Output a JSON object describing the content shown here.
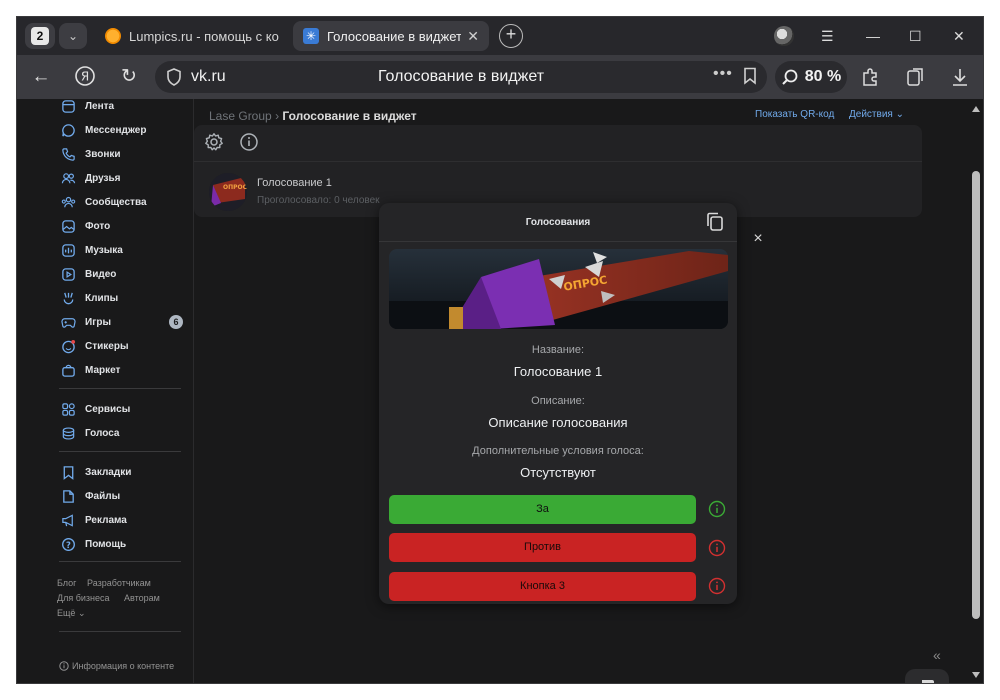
{
  "browser": {
    "tab_count": "2",
    "tabs": [
      {
        "title": "Lumpics.ru - помощь с компьютером",
        "active": false
      },
      {
        "title": "Голосование в виджет",
        "active": true
      }
    ],
    "address": {
      "domain": "vk.ru",
      "page_title": "Голосование в виджет",
      "zoom": "80 %"
    },
    "icons": [
      "back-arrow-icon",
      "yandex-icon",
      "reload-icon",
      "shield-icon",
      "more-icon",
      "bookmark-icon",
      "zoom-icon",
      "extensions-icon",
      "collections-icon",
      "downloads-icon"
    ]
  },
  "sidebar": {
    "items": [
      {
        "label": "Лента",
        "icon": "newsfeed-icon"
      },
      {
        "label": "Мессенджер",
        "icon": "messenger-icon"
      },
      {
        "label": "Звонки",
        "icon": "phone-icon"
      },
      {
        "label": "Друзья",
        "icon": "friends-icon"
      },
      {
        "label": "Сообщества",
        "icon": "communities-icon"
      },
      {
        "label": "Фото",
        "icon": "photo-icon"
      },
      {
        "label": "Музыка",
        "icon": "music-icon"
      },
      {
        "label": "Видео",
        "icon": "video-icon"
      },
      {
        "label": "Клипы",
        "icon": "clips-icon"
      },
      {
        "label": "Игры",
        "icon": "games-icon",
        "badge": "6"
      },
      {
        "label": "Стикеры",
        "icon": "stickers-icon"
      },
      {
        "label": "Маркет",
        "icon": "market-icon"
      },
      {
        "label": "Сервисы",
        "icon": "services-icon"
      },
      {
        "label": "Голоса",
        "icon": "votes-icon"
      },
      {
        "label": "Закладки",
        "icon": "bookmarks-icon"
      },
      {
        "label": "Файлы",
        "icon": "files-icon"
      },
      {
        "label": "Реклама",
        "icon": "ads-icon"
      },
      {
        "label": "Помощь",
        "icon": "help-icon"
      }
    ],
    "footer_links": [
      "Блог",
      "Разработчикам",
      "Для бизнеса",
      "Авторам",
      "Ещё"
    ],
    "content_info": "Информация о контенте"
  },
  "main": {
    "breadcrumb": {
      "parent": "Lase Group",
      "current": "Голосование в виджет"
    },
    "actions": [
      "Показать QR-код",
      "Действия"
    ],
    "poll": {
      "name": "Голосование 1",
      "voted": "Проголосовало: 0 человек"
    }
  },
  "modal": {
    "title": "Голосования",
    "cover_text": "ОПРОС",
    "fields": [
      {
        "label": "Название:",
        "value": "Голосование 1"
      },
      {
        "label": "Описание:",
        "value": "Описание голосования"
      },
      {
        "label": "Дополнительные условия голоса:",
        "value": "Отсутствуют"
      }
    ],
    "buttons": [
      {
        "label": "За",
        "color": "#3aaa35",
        "info_color": "#3aaa35"
      },
      {
        "label": "Против",
        "color": "#c92323",
        "info_color": "#d23030"
      },
      {
        "label": "Кнопка 3",
        "color": "#c92323",
        "info_color": "#d23030"
      }
    ],
    "close": "×"
  }
}
